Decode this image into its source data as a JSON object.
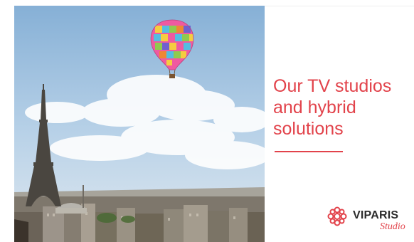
{
  "hero": {
    "image_alt": "Hot air balloon over Paris with the Eiffel Tower"
  },
  "headline": {
    "lines": [
      "Our TV studios",
      "and hybrid",
      "solutions"
    ]
  },
  "logo": {
    "wordmark": "VIPARIS",
    "subtitle": "Studio"
  },
  "colors": {
    "accent": "#e2434b",
    "sky_top": "#8fb7d9",
    "sky_bottom": "#cfe0ee"
  }
}
